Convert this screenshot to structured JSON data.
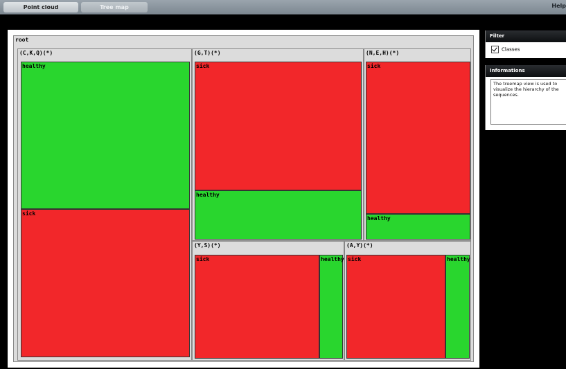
{
  "tabs": [
    "Point cloud",
    "Tree map"
  ],
  "help_label": "Help",
  "treemap": {
    "root_label": "root",
    "nodes": [
      {
        "label": "(C,K,Q)(*)",
        "leaves": [
          "healthy",
          "sick"
        ]
      },
      {
        "label": "(G,T)(*)",
        "leaves": [
          "sick",
          "healthy"
        ]
      },
      {
        "label": "(N,E,H)(*)",
        "leaves": [
          "sick",
          "healthy"
        ]
      },
      {
        "label": "(Y,S)(*)",
        "leaves": [
          "sick",
          "healthy"
        ]
      },
      {
        "label": "(A,Y)(*)",
        "leaves": [
          "sick",
          "healthy"
        ]
      }
    ]
  },
  "colors": {
    "sick": "#f2272a",
    "healthy": "#29d62e"
  },
  "filter": {
    "title": "Filter",
    "classes_label": "Classes",
    "classes_checked": true
  },
  "info": {
    "title": "Informations",
    "text": "The treemap view is used to visualize the hierarchy of the sequences."
  }
}
